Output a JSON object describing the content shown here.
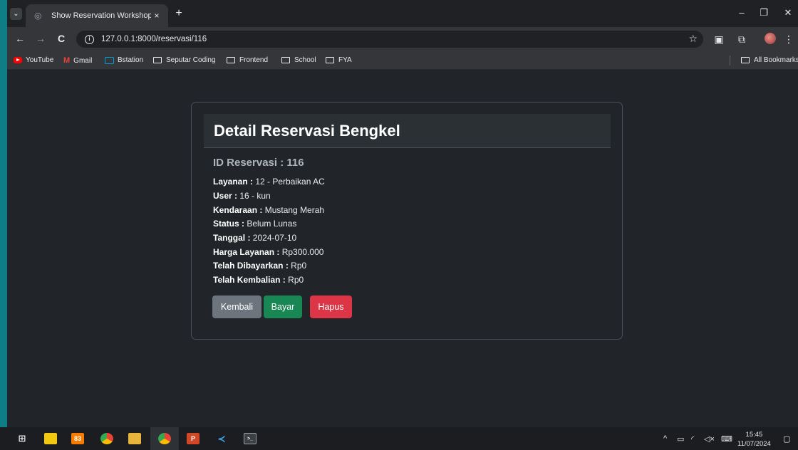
{
  "browser": {
    "tab": {
      "title": "Show Reservation Workshop",
      "close_glyph": "×"
    },
    "new_tab_glyph": "+",
    "window_controls": {
      "minimize": "–",
      "restore": "❐",
      "close": "✕"
    },
    "nav": {
      "back": "←",
      "forward": "→",
      "reload": "C"
    },
    "url": "127.0.0.1:8000/reservasi/116",
    "bookmarks": [
      {
        "label": "YouTube",
        "icon": "youtube-icon"
      },
      {
        "label": "Gmail",
        "icon": "gmail-icon"
      },
      {
        "label": "Bstation",
        "icon": "bstation-icon"
      },
      {
        "label": "Seputar Coding",
        "icon": "folder-icon"
      },
      {
        "label": "Frontend",
        "icon": "folder-icon"
      },
      {
        "label": "School",
        "icon": "folder-icon"
      },
      {
        "label": "FYA",
        "icon": "folder-icon"
      }
    ],
    "all_bookmarks": "All Bookmarks"
  },
  "card": {
    "title": "Detail Reservasi Bengkel",
    "id_label": "ID Reservasi : 116",
    "fields": [
      {
        "label": "Layanan :",
        "value": "12 - Perbaikan AC"
      },
      {
        "label": "User :",
        "value": "16 - kun"
      },
      {
        "label": "Kendaraan :",
        "value": "Mustang Merah"
      },
      {
        "label": "Status :",
        "value": "Belum Lunas"
      },
      {
        "label": "Tanggal :",
        "value": "2024-07-10"
      },
      {
        "label": "Harga Layanan :",
        "value": "Rp300.000"
      },
      {
        "label": "Telah Dibayarkan :",
        "value": "Rp0"
      },
      {
        "label": "Telah Kembalian :",
        "value": "Rp0"
      }
    ],
    "buttons": {
      "back": "Kembali",
      "pay": "Bayar",
      "delete": "Hapus"
    }
  },
  "colors": {
    "btn_back": "#6c757d",
    "btn_pay": "#198754",
    "btn_delete": "#dc3545",
    "page_bg": "#212529"
  },
  "taskbar": {
    "time": "15:45",
    "date": "11/07/2024"
  }
}
